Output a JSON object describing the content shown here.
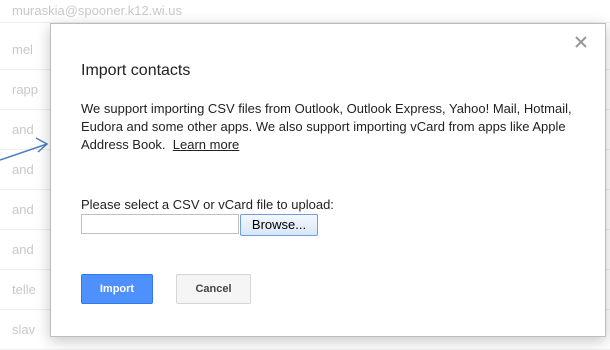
{
  "background": {
    "rows": [
      "muraskia@spooner.k12.wi.us",
      "mel",
      "rapp",
      "and",
      "and",
      "and",
      "and",
      "telle",
      "slav"
    ]
  },
  "dialog": {
    "title": "Import contacts",
    "description": "We support importing CSV files from Outlook, Outlook Express, Yahoo! Mail, Hotmail, Eudora and some other apps. We also support importing vCard from apps like Apple Address Book.",
    "learn_more": "Learn more",
    "select_label": "Please select a CSV or vCard file to upload:",
    "file_value": "",
    "browse_label": "Browse...",
    "import_label": "Import",
    "cancel_label": "Cancel",
    "close_icon": "close-icon"
  },
  "colors": {
    "primary_button": "#4d90fe",
    "arrow": "#4a7fc1"
  }
}
